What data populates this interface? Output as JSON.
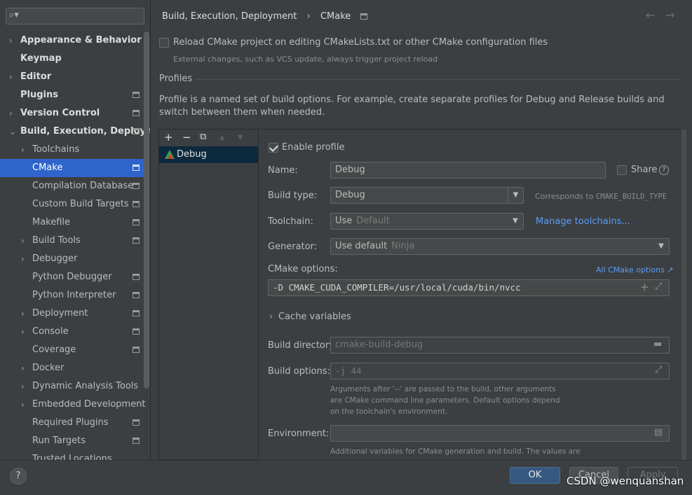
{
  "sidebar": {
    "search_placeholder": "",
    "items": [
      {
        "label": "Appearance & Behavior",
        "arrow": "›"
      },
      {
        "label": "Keymap"
      },
      {
        "label": "Editor",
        "arrow": "›"
      },
      {
        "label": "Plugins"
      },
      {
        "label": "Version Control",
        "arrow": "›"
      },
      {
        "label": "Build, Execution, Deploymen",
        "arrow": "⌄"
      },
      {
        "label": "Toolchains",
        "arrow": "›"
      },
      {
        "label": "CMake"
      },
      {
        "label": "Compilation Database"
      },
      {
        "label": "Custom Build Targets"
      },
      {
        "label": "Makefile"
      },
      {
        "label": "Build Tools",
        "arrow": "›"
      },
      {
        "label": "Debugger",
        "arrow": "›"
      },
      {
        "label": "Python Debugger"
      },
      {
        "label": "Python Interpreter"
      },
      {
        "label": "Deployment",
        "arrow": "›"
      },
      {
        "label": "Console",
        "arrow": "›"
      },
      {
        "label": "Coverage"
      },
      {
        "label": "Docker",
        "arrow": "›"
      },
      {
        "label": "Dynamic Analysis Tools",
        "arrow": "›"
      },
      {
        "label": "Embedded Development",
        "arrow": "›"
      },
      {
        "label": "Required Plugins"
      },
      {
        "label": "Run Targets"
      },
      {
        "label": "Trusted Locations"
      }
    ]
  },
  "header": {
    "crumb_parent": "Build, Execution, Deployment",
    "crumb_sep": "›",
    "crumb_current": "CMake",
    "back_icon": "←",
    "forward_icon": "→"
  },
  "reload": {
    "label": "Reload CMake project on editing CMakeLists.txt or other CMake configuration files",
    "note": "External changes, such as VCS update, always trigger project reload",
    "checked": false
  },
  "profiles": {
    "title": "Profiles",
    "description": "Profile is a named set of build options. For example, create separate profiles for Debug and Release builds and switch between them when needed.",
    "toolbar": {
      "add": "+",
      "remove": "−",
      "copy": "⧉",
      "up": "▲",
      "down": "▼"
    },
    "list": [
      {
        "name": "Debug",
        "selected": true
      }
    ]
  },
  "detail": {
    "enable_label": "Enable profile",
    "enable_checked": true,
    "name_label": "Name:",
    "name_value": "Debug",
    "share_label": "Share",
    "build_type_label": "Build type:",
    "build_type_value": "Debug",
    "build_type_note": "Corresponds to",
    "build_type_var": "CMAKE_BUILD_TYPE",
    "toolchain_label": "Toolchain:",
    "toolchain_value": "Use",
    "toolchain_hint": "Default",
    "manage_toolchains": "Manage toolchains...",
    "generator_label": "Generator:",
    "generator_value": "Use default",
    "generator_hint": "Ninja",
    "cmake_options_label": "CMake options:",
    "all_cmake_options": "All CMake options ↗",
    "cmake_options_value": "-D CMAKE_CUDA_COMPILER=/usr/local/cuda/bin/nvcc",
    "cache_variables_label": "Cache variables",
    "build_dir_label": "Build directory:",
    "build_dir_value": "cmake-build-debug",
    "build_options_label": "Build options:",
    "build_options_value": "-j 44",
    "build_options_note": "Arguments after '--' are passed to the build, other arguments are CMake command line parameters. Default options depend on the toolchain's environment.",
    "environment_label": "Environment:",
    "environment_value": "",
    "environment_note": "Additional variables for CMake generation and build. The values are"
  },
  "buttons": {
    "help": "?",
    "ok": "OK",
    "cancel": "Cancel",
    "apply": "Apply"
  },
  "watermark": "CSDN @wenquanshan"
}
